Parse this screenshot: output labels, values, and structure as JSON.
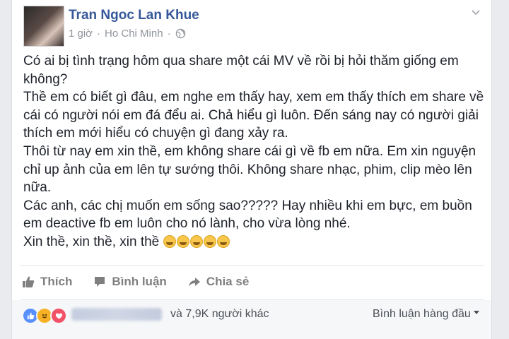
{
  "post": {
    "author": "Tran Ngoc Lan Khue",
    "time": "1 giờ",
    "separator": "·",
    "location": "Ho Chi Minh",
    "location_separator": "·",
    "lines": [
      "Có ai bị tình trạng hôm qua share một cái MV về rồi bị hỏi thăm giống em",
      "không?",
      "Thề em có biết gì đâu, em nghe em thấy hay, xem em thấy thích em share về",
      "cái có người nói em đá đểu ai. Chả hiểu gì luôn. Đến sáng nay có người giải",
      "thích em mới hiểu có chuyện gì đang xảy ra.",
      "Thôi từ nay em xin thề, em không share cái gì về fb em nữa. Em xin nguyện",
      "chỉ up ảnh của em lên tự sướng thôi. Không share nhạc, phim, clip mèo lên",
      "nữa.",
      "Các anh, các chị muốn em sống sao????? Hay nhiều khi em bực, em buồn",
      "em deactive fb em luôn cho nó lành, cho vừa lòng nhé."
    ],
    "last_line": "Xin thề, xin thề, xin thề",
    "emoji_icon": "grinning-squint-emoji",
    "emoji_count": 5
  },
  "actions": {
    "like": "Thích",
    "comment": "Bình luận",
    "share": "Chia sẻ"
  },
  "footer": {
    "reaction_icons": [
      "like-reaction-icon",
      "haha-reaction-icon",
      "love-reaction-icon"
    ],
    "others_text": "và 7,9K người khác",
    "sort_label": "Bình luận hàng đầu"
  },
  "colors": {
    "author_link": "#365899",
    "meta_gray": "#90949c",
    "like_blue": "#5890ff",
    "haha_yellow": "#f7b125",
    "love_red": "#f25268",
    "footer_bg": "#f6f7f9"
  }
}
